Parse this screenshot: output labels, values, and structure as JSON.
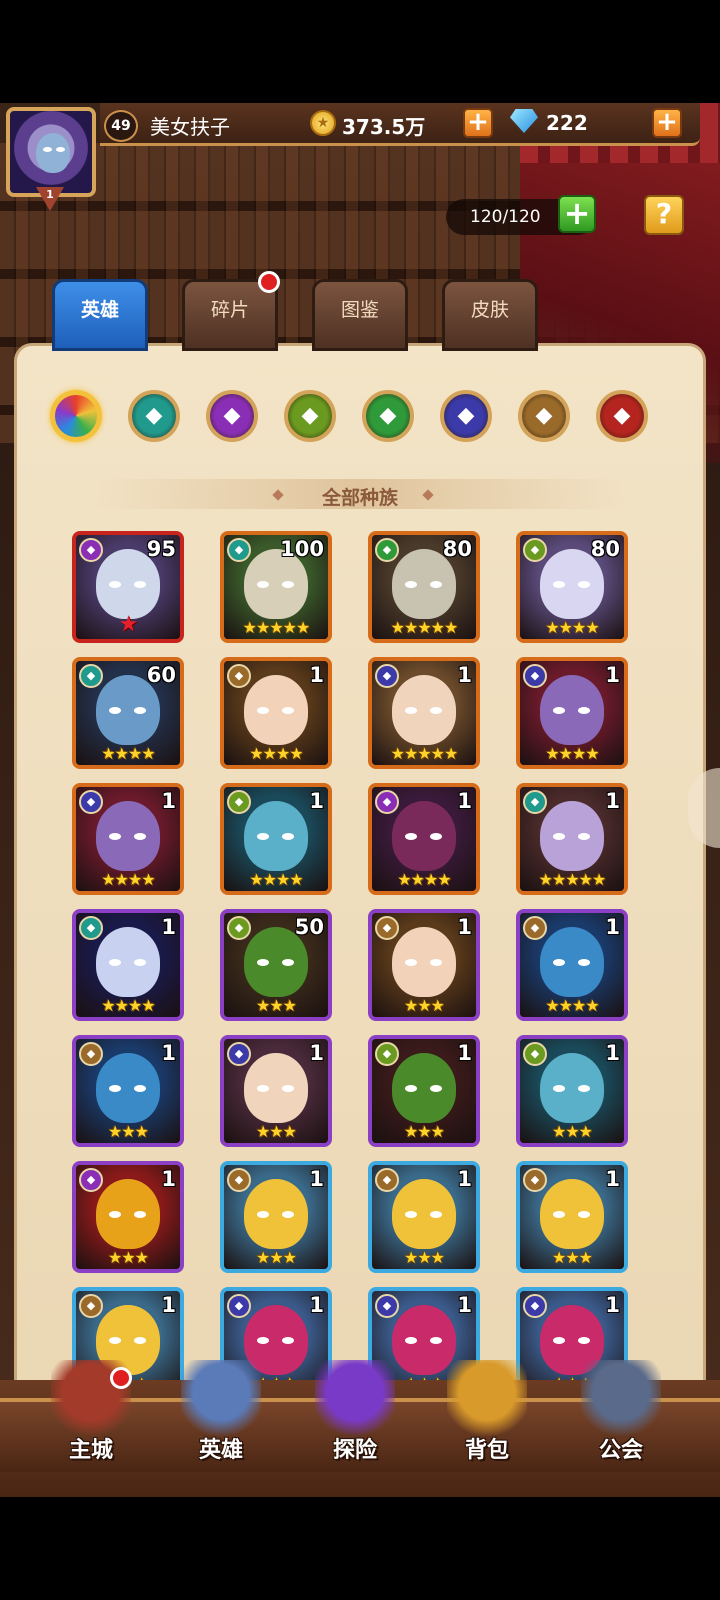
{
  "player": {
    "level": "49",
    "name": "美女扶子",
    "vip": "1",
    "gold": "373.5万",
    "gems": "222",
    "stamina": "120/120"
  },
  "icons": {
    "plus": "+",
    "help": "?"
  },
  "tabs": [
    {
      "label": "英雄",
      "active": true
    },
    {
      "label": "碎片",
      "badge": true
    },
    {
      "label": "图鉴"
    },
    {
      "label": "皮肤"
    }
  ],
  "factions": [
    {
      "name": "all-factions-icon",
      "color": "#e8c23a",
      "active": true
    },
    {
      "name": "faction-forest-icon",
      "color": "#1f9a8c"
    },
    {
      "name": "faction-dark-icon",
      "color": "#8a2fb5"
    },
    {
      "name": "faction-nature-icon",
      "color": "#6a9a1f"
    },
    {
      "name": "faction-leaf-icon",
      "color": "#2f9a3a"
    },
    {
      "name": "faction-abyss-icon",
      "color": "#3b3aa8"
    },
    {
      "name": "faction-light-icon",
      "color": "#9a6a2a"
    },
    {
      "name": "faction-fire-icon",
      "color": "#b5251f"
    }
  ],
  "filter_label": "全部种族",
  "heroes": [
    {
      "level": "95",
      "stars": "★",
      "rarity": "red",
      "faction": "dark",
      "skin": "#cfd8ea",
      "bg": "#4a3a6a",
      "redstar": true
    },
    {
      "level": "100",
      "stars": "★★★★★",
      "rarity": "orange",
      "faction": "forest",
      "skin": "#d8cfb8",
      "bg": "#3a5a2a"
    },
    {
      "level": "80",
      "stars": "★★★★★",
      "rarity": "orange",
      "faction": "leaf",
      "skin": "#c8c2b0",
      "bg": "#4a3a2a"
    },
    {
      "level": "80",
      "stars": "★★★★",
      "rarity": "orange",
      "faction": "nature",
      "skin": "#d8d6f0",
      "bg": "#5a4a7a"
    },
    {
      "level": "60",
      "stars": "★★★★",
      "rarity": "orange",
      "faction": "forest",
      "skin": "#6a9ac8",
      "bg": "#23304a"
    },
    {
      "level": "1",
      "stars": "★★★★",
      "rarity": "orange",
      "faction": "light",
      "skin": "#f2d2b8",
      "bg": "#5a3a1a"
    },
    {
      "level": "1",
      "stars": "★★★★★",
      "rarity": "orange",
      "faction": "abyss",
      "skin": "#f0d4bc",
      "bg": "#6a4a2a"
    },
    {
      "level": "1",
      "stars": "★★★★",
      "rarity": "orange",
      "faction": "abyss",
      "skin": "#8a6ab8",
      "bg": "#6a1a2a"
    },
    {
      "level": "1",
      "stars": "★★★★",
      "rarity": "orange",
      "faction": "abyss",
      "skin": "#8a6ab8",
      "bg": "#6a1a2a"
    },
    {
      "level": "1",
      "stars": "★★★★",
      "rarity": "orange",
      "faction": "nature",
      "skin": "#5ab0c8",
      "bg": "#1a4a5a"
    },
    {
      "level": "1",
      "stars": "★★★★",
      "rarity": "orange",
      "faction": "dark",
      "skin": "#7a2a5a",
      "bg": "#3a1a3a"
    },
    {
      "level": "1",
      "stars": "★★★★★",
      "rarity": "orange",
      "faction": "forest",
      "skin": "#b8a2d8",
      "bg": "#4a2a2a"
    },
    {
      "level": "1",
      "stars": "★★★★",
      "rarity": "purple",
      "faction": "forest",
      "skin": "#c8d2f0",
      "bg": "#1a1a4a"
    },
    {
      "level": "50",
      "stars": "★★★",
      "rarity": "purple",
      "faction": "nature",
      "skin": "#4a8a2a",
      "bg": "#3a2a1a"
    },
    {
      "level": "1",
      "stars": "★★★",
      "rarity": "purple",
      "faction": "light",
      "skin": "#f2d2b8",
      "bg": "#5a3a1a"
    },
    {
      "level": "1",
      "stars": "★★★★",
      "rarity": "purple",
      "faction": "light",
      "skin": "#3a8ac8",
      "bg": "#1a3a6a"
    },
    {
      "level": "1",
      "stars": "★★★",
      "rarity": "purple",
      "faction": "light",
      "skin": "#3a8ac8",
      "bg": "#1a3a6a"
    },
    {
      "level": "1",
      "stars": "★★★",
      "rarity": "purple",
      "faction": "abyss",
      "skin": "#f0d4bc",
      "bg": "#4a2a3a"
    },
    {
      "level": "1",
      "stars": "★★★",
      "rarity": "purple",
      "faction": "nature",
      "skin": "#4a8a2a",
      "bg": "#3a1a1a"
    },
    {
      "level": "1",
      "stars": "★★★",
      "rarity": "purple",
      "faction": "nature",
      "skin": "#5ab0c8",
      "bg": "#1a4a5a"
    },
    {
      "level": "1",
      "stars": "★★★",
      "rarity": "purple",
      "faction": "dark",
      "skin": "#e8a21a",
      "bg": "#8a1a1a"
    },
    {
      "level": "1",
      "stars": "★★★",
      "rarity": "blue",
      "faction": "light",
      "skin": "#f0c23a",
      "bg": "#3a6a8a"
    },
    {
      "level": "1",
      "stars": "★★★",
      "rarity": "blue",
      "faction": "light",
      "skin": "#f0c23a",
      "bg": "#3a6a8a"
    },
    {
      "level": "1",
      "stars": "★★★",
      "rarity": "blue",
      "faction": "light",
      "skin": "#f0c23a",
      "bg": "#3a6a8a"
    },
    {
      "level": "1",
      "stars": "★★★",
      "rarity": "blue",
      "faction": "light",
      "skin": "#f0c23a",
      "bg": "#3a6a8a"
    },
    {
      "level": "1",
      "stars": "★★★",
      "rarity": "blue",
      "faction": "abyss",
      "skin": "#c82a6a",
      "bg": "#3a5a8a"
    },
    {
      "level": "1",
      "stars": "★★★",
      "rarity": "blue",
      "faction": "abyss",
      "skin": "#c82a6a",
      "bg": "#3a5a8a"
    },
    {
      "level": "1",
      "stars": "★★★",
      "rarity": "blue",
      "faction": "abyss",
      "skin": "#c82a6a",
      "bg": "#3a5a8a"
    }
  ],
  "bottom_nav": [
    {
      "label": "主城",
      "icon": "castle-icon",
      "badge": true,
      "color": "#a33a2a"
    },
    {
      "label": "英雄",
      "icon": "hero-icon",
      "color": "#5a7ab8"
    },
    {
      "label": "探险",
      "icon": "portal-icon",
      "color": "#7a3ac8"
    },
    {
      "label": "背包",
      "icon": "backpack-icon",
      "color": "#d89a2a"
    },
    {
      "label": "公会",
      "icon": "guild-icon",
      "color": "#5a6a8a"
    }
  ],
  "colors": {
    "rarity_red": "#c8241e",
    "rarity_orange": "#d66b1a",
    "rarity_purple": "#8a3fc4",
    "rarity_blue": "#3ca9e0",
    "tab_active": "#1e5fba",
    "star": "#ffd42a"
  }
}
